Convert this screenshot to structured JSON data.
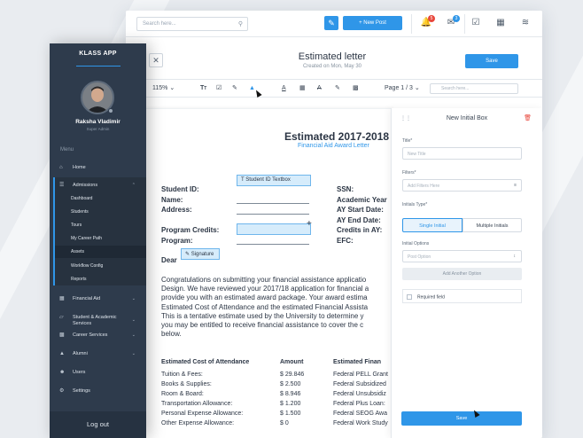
{
  "topbar": {
    "search_placeholder": "Search here...",
    "new_post_label": "+ New Post",
    "notifications_count": "5",
    "messages_count": "3"
  },
  "header": {
    "title": "Estimated letter",
    "subtitle": "Created on Mon, May 30",
    "save_label": "Save"
  },
  "toolbar": {
    "zoom": "115%",
    "page_indicator": "Page 1 / 3",
    "search_placeholder": "Search here..."
  },
  "document": {
    "title": "Estimated 2017-2018",
    "subtitle": "Financial Aid Award Letter",
    "left_fields": [
      "Student ID:",
      "Name:",
      "Address:",
      "Program Credits:",
      "Program:"
    ],
    "right_fields": [
      "SSN:",
      "Academic Year",
      "AY Start Date:",
      "AY End Date:",
      "Credits in AY:",
      "EFC:"
    ],
    "student_id_tag": "Student ID Textbox",
    "signature_tag": "Signature",
    "greeting": "Dear",
    "paragraph_lines": [
      "Congratulations on submitting your financial assistance applicatio",
      "Design. We have reviewed your 2017/18 application for financial a",
      "provide you with an estimated award package. Your award estima",
      "Estimated Cost of Attendance and the estimated Financial Assista",
      "This is a tentative estimate used by the University to determine y",
      "you may be entitled to receive financial assistance to cover the c",
      "below."
    ],
    "cost_header": "Estimated Cost of Attendance",
    "amount_header": "Amount",
    "financial_header": "Estimated Finan",
    "cost_rows": [
      {
        "label": "Tuition & Fees:",
        "amount": "$ 29.846",
        "aid": "Federal PELL Grant"
      },
      {
        "label": "Books & Supplies:",
        "amount": "$ 2.500",
        "aid": "Federal Subsidized"
      },
      {
        "label": "Room & Board:",
        "amount": "$ 8.946",
        "aid": "Federal Unsubsidiz"
      },
      {
        "label": "Transportation Allowance:",
        "amount": "$ 1.200",
        "aid": "Federal Plus Loan:"
      },
      {
        "label": "Personal Expense Allowance:",
        "amount": "$ 1.500",
        "aid": "Federal SEOG Awa"
      },
      {
        "label": "Other Expense Allowance:",
        "amount": "$ 0",
        "aid": "Federal Work Study"
      }
    ]
  },
  "panel": {
    "title": "New Initial Box",
    "title_label": "Title*",
    "title_placeholder": "New Title",
    "filters_label": "Filters*",
    "filters_placeholder": "Add Filters Here",
    "initials_type_label": "Initials Type*",
    "single_initial": "Single Initial",
    "multiple_initials": "Multiple Initials",
    "initial_options_label": "Initial Options",
    "post_option_placeholder": "Post Option",
    "add_option_label": "Add Another Option",
    "required_label": "Required field",
    "save_label": "Save"
  },
  "sidebar": {
    "brand": "KLASS APP",
    "user_name": "Raksha Vladimir",
    "user_role": "Super Admin",
    "menu_heading": "Menu",
    "items": [
      {
        "label": "Home",
        "icon": "home-icon"
      },
      {
        "label": "Admissions",
        "icon": "layers-icon"
      },
      {
        "label": "Financial Aid",
        "icon": "money-icon"
      },
      {
        "label": "Student & Academic Services",
        "icon": "graduation-icon"
      },
      {
        "label": "Career Services",
        "icon": "briefcase-icon"
      },
      {
        "label": "Alumni",
        "icon": "cap-icon"
      },
      {
        "label": "Users",
        "icon": "users-icon"
      },
      {
        "label": "Settings",
        "icon": "gear-icon"
      }
    ],
    "admissions_sub": [
      "Dashboard",
      "Students",
      "Tours",
      "My Career Path",
      "Assets",
      "Workflow Config",
      "Reports"
    ],
    "logout": "Log out"
  },
  "colors": {
    "accent": "#2f96e8",
    "sidebar": "#2e3b4c",
    "badge_red": "#e8473c"
  }
}
